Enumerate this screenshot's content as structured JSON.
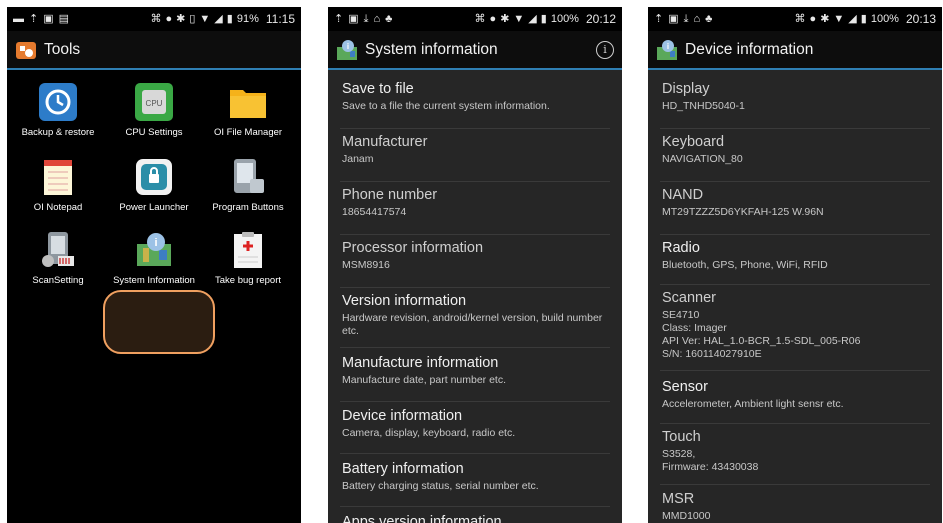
{
  "colors": {
    "accent_line": "#2f7fb3",
    "list_bg": "#262626",
    "highlight": "#f0a060"
  },
  "screen1": {
    "status": {
      "battery": "91%",
      "time": "11:15"
    },
    "title": "Tools",
    "apps": [
      {
        "label": "Backup & restore",
        "icon": "backup-restore-icon"
      },
      {
        "label": "CPU Settings",
        "icon": "cpu-icon"
      },
      {
        "label": "OI File Manager",
        "icon": "folder-icon"
      },
      {
        "label": "OI Notepad",
        "icon": "notepad-icon"
      },
      {
        "label": "Power Launcher",
        "icon": "power-launcher-icon"
      },
      {
        "label": "Program Buttons",
        "icon": "program-buttons-icon"
      },
      {
        "label": "ScanSetting",
        "icon": "scan-setting-icon"
      },
      {
        "label": "System Information",
        "icon": "system-information-icon"
      },
      {
        "label": "Take bug report",
        "icon": "bug-report-icon"
      }
    ]
  },
  "screen2": {
    "status": {
      "battery": "100%",
      "time": "20:12"
    },
    "title": "System information",
    "items": [
      {
        "title": "Save to file",
        "subtitle": "Save to a file the current system information."
      },
      {
        "title": "Manufacturer",
        "subtitle": "Janam"
      },
      {
        "title": "Phone number",
        "subtitle": "18654417574"
      },
      {
        "title": "Processor information",
        "subtitle": "MSM8916"
      },
      {
        "title": "Version information",
        "subtitle": "Hardware revision, android/kernel version, build number etc."
      },
      {
        "title": "Manufacture information",
        "subtitle": "Manufacture date, part number etc."
      },
      {
        "title": "Device information",
        "subtitle": "Camera, display, keyboard, radio etc."
      },
      {
        "title": "Battery information",
        "subtitle": "Battery charging status, serial number etc."
      },
      {
        "title": "Apps version information",
        "subtitle": ""
      }
    ]
  },
  "screen3": {
    "status": {
      "battery": "100%",
      "time": "20:13"
    },
    "title": "Device information",
    "items": [
      {
        "title": "Display",
        "lines": [
          "HD_TNHD5040-1"
        ]
      },
      {
        "title": "Keyboard",
        "lines": [
          "NAVIGATION_80"
        ]
      },
      {
        "title": "NAND",
        "lines": [
          "MT29TZZZ5D6YKFAH-125 W.96N"
        ]
      },
      {
        "title": "Radio",
        "lines": [
          "Bluetooth, GPS, Phone, WiFi, RFID"
        ]
      },
      {
        "title": "Scanner",
        "lines": [
          "SE4710",
          "Class: Imager",
          "API Ver: HAL_1.0-BCR_1.5-SDL_005-R06",
          "S/N: 160114027910E"
        ]
      },
      {
        "title": "Sensor",
        "lines": [
          "Accelerometer, Ambient light sensr etc."
        ]
      },
      {
        "title": "Touch",
        "lines": [
          "S3528,",
          "Firmware: 43430038"
        ]
      },
      {
        "title": "MSR",
        "lines": [
          "MMD1000"
        ]
      }
    ]
  }
}
